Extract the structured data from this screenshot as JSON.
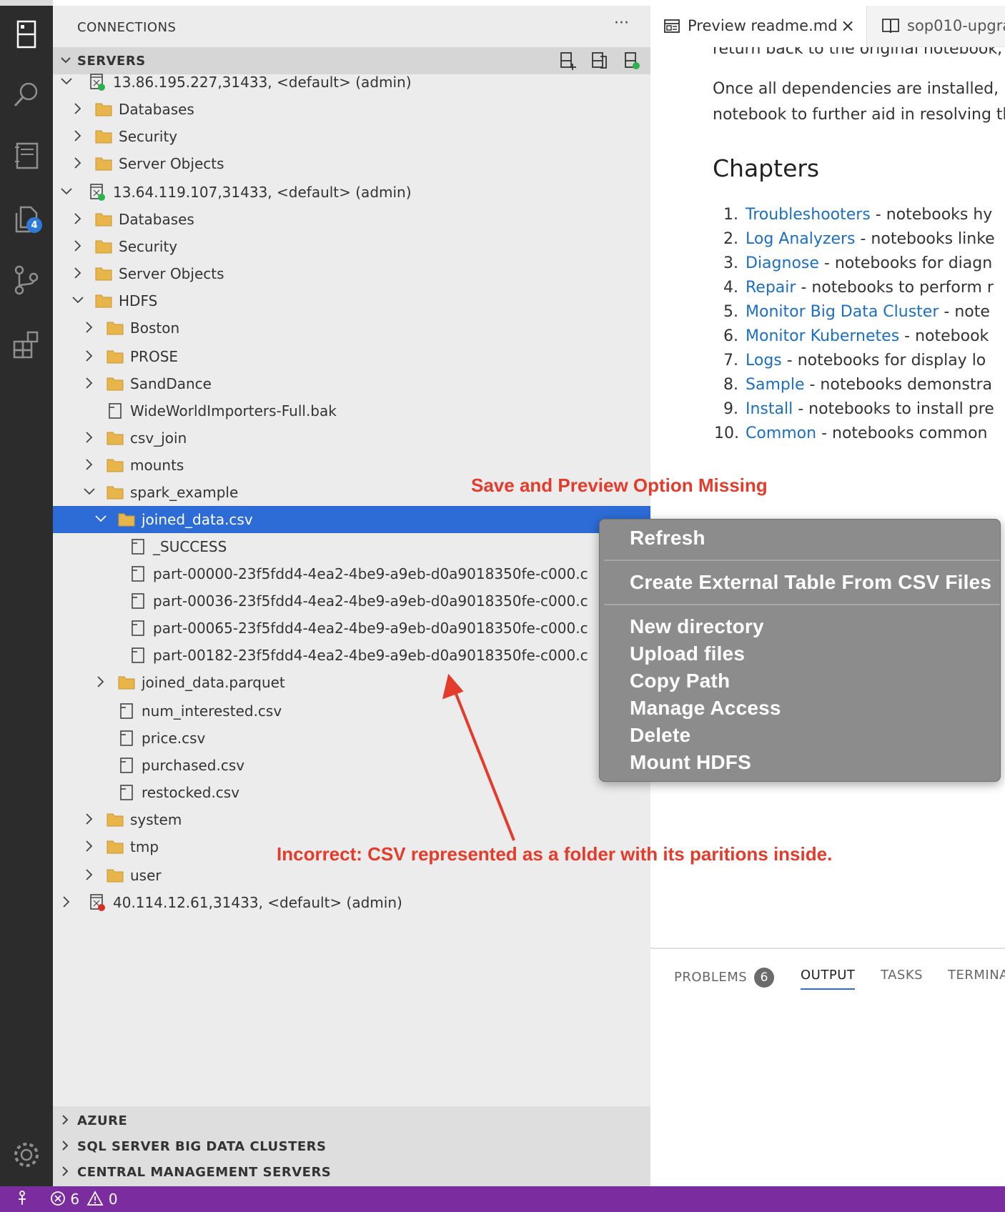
{
  "activity_bar": {
    "icons": [
      "explorer-icon",
      "search-icon",
      "notebook-icon",
      "files-icon",
      "source-control-icon",
      "extensions-icon",
      "gear-icon"
    ],
    "files_badge": "4"
  },
  "sidebar": {
    "title": "CONNECTIONS",
    "more": "···",
    "servers_label": "SERVERS",
    "tree": [
      {
        "label": "13.86.195.227,31433, <default> (admin)",
        "type": "server"
      },
      {
        "label": "Databases",
        "type": "folder"
      },
      {
        "label": "Security",
        "type": "folder"
      },
      {
        "label": "Server Objects",
        "type": "folder"
      },
      {
        "label": "13.64.119.107,31433, <default> (admin)",
        "type": "server"
      },
      {
        "label": "Databases",
        "type": "folder"
      },
      {
        "label": "Security",
        "type": "folder"
      },
      {
        "label": "Server Objects",
        "type": "folder"
      },
      {
        "label": "HDFS",
        "type": "folder"
      },
      {
        "label": "Boston",
        "type": "folder"
      },
      {
        "label": "PROSE",
        "type": "folder"
      },
      {
        "label": "SandDance",
        "type": "folder"
      },
      {
        "label": "WideWorldImporters-Full.bak",
        "type": "file"
      },
      {
        "label": "csv_join",
        "type": "folder"
      },
      {
        "label": "mounts",
        "type": "folder"
      },
      {
        "label": "spark_example",
        "type": "folder"
      },
      {
        "label": "joined_data.csv",
        "type": "folder",
        "selected": true
      },
      {
        "label": "_SUCCESS",
        "type": "file"
      },
      {
        "label": "part-00000-23f5fdd4-4ea2-4be9-a9eb-d0a9018350fe-c000.c",
        "type": "file"
      },
      {
        "label": "part-00036-23f5fdd4-4ea2-4be9-a9eb-d0a9018350fe-c000.c",
        "type": "file"
      },
      {
        "label": "part-00065-23f5fdd4-4ea2-4be9-a9eb-d0a9018350fe-c000.c",
        "type": "file"
      },
      {
        "label": "part-00182-23f5fdd4-4ea2-4be9-a9eb-d0a9018350fe-c000.c",
        "type": "file"
      },
      {
        "label": "joined_data.parquet",
        "type": "folder"
      },
      {
        "label": "num_interested.csv",
        "type": "file"
      },
      {
        "label": "price.csv",
        "type": "file"
      },
      {
        "label": "purchased.csv",
        "type": "file"
      },
      {
        "label": "restocked.csv",
        "type": "file"
      },
      {
        "label": "system",
        "type": "folder"
      },
      {
        "label": "tmp",
        "type": "folder"
      },
      {
        "label": "user",
        "type": "folder"
      },
      {
        "label": "40.114.12.61,31433, <default> (admin)",
        "type": "server"
      }
    ],
    "sections": [
      "AZURE",
      "SQL SERVER BIG DATA CLUSTERS",
      "CENTRAL MANAGEMENT SERVERS"
    ]
  },
  "editor": {
    "tabs": [
      {
        "label": "Preview readme.md",
        "close": "×"
      },
      {
        "label": "sop010-upgra"
      }
    ],
    "lines": [
      "return back to the original notebook,",
      "Once all dependencies are installed, I",
      "notebook to further aid in resolving th"
    ],
    "heading": "Chapters",
    "chapters": [
      {
        "n": "1.",
        "link": "Troubleshooters",
        "rest": " - notebooks hy"
      },
      {
        "n": "2.",
        "link": "Log Analyzers",
        "rest": " - notebooks linke"
      },
      {
        "n": "3.",
        "link": "Diagnose",
        "rest": " - notebooks for diagn"
      },
      {
        "n": "4.",
        "link": "Repair",
        "rest": " - notebooks to perform r"
      },
      {
        "n": "5.",
        "link": "Monitor Big Data Cluster",
        "rest": " - note"
      },
      {
        "n": "6.",
        "link": "Monitor Kubernetes",
        "rest": " - notebook"
      },
      {
        "n": "7.",
        "link": "Logs",
        "rest": " - notebooks for display lo"
      },
      {
        "n": "8.",
        "link": "Sample",
        "rest": " - notebooks demonstra"
      },
      {
        "n": "9.",
        "link": "Install",
        "rest": " - notebooks to install pre"
      },
      {
        "n": "10.",
        "link": "Common",
        "rest": " - notebooks common"
      }
    ]
  },
  "panel": {
    "tabs": [
      "PROBLEMS",
      "OUTPUT",
      "TASKS",
      "TERMINA"
    ],
    "problems_count": "6"
  },
  "context_menu": {
    "items": [
      "Refresh",
      "Create External Table From CSV Files",
      "New directory",
      "Upload files",
      "Copy Path",
      "Manage Access",
      "Delete",
      "Mount HDFS"
    ]
  },
  "annotations": {
    "top": "Save and Preview Option Missing",
    "bottom": "Incorrect: CSV represented as a folder with its paritions inside."
  },
  "status_bar": {
    "errors": "6",
    "warnings": "0"
  },
  "colors": {
    "selection": "#2d6bd6",
    "link": "#1a6fc4",
    "annotation": "#e53b2b",
    "status_bar": "#7b2c9e",
    "folder": "#e8b54a"
  }
}
